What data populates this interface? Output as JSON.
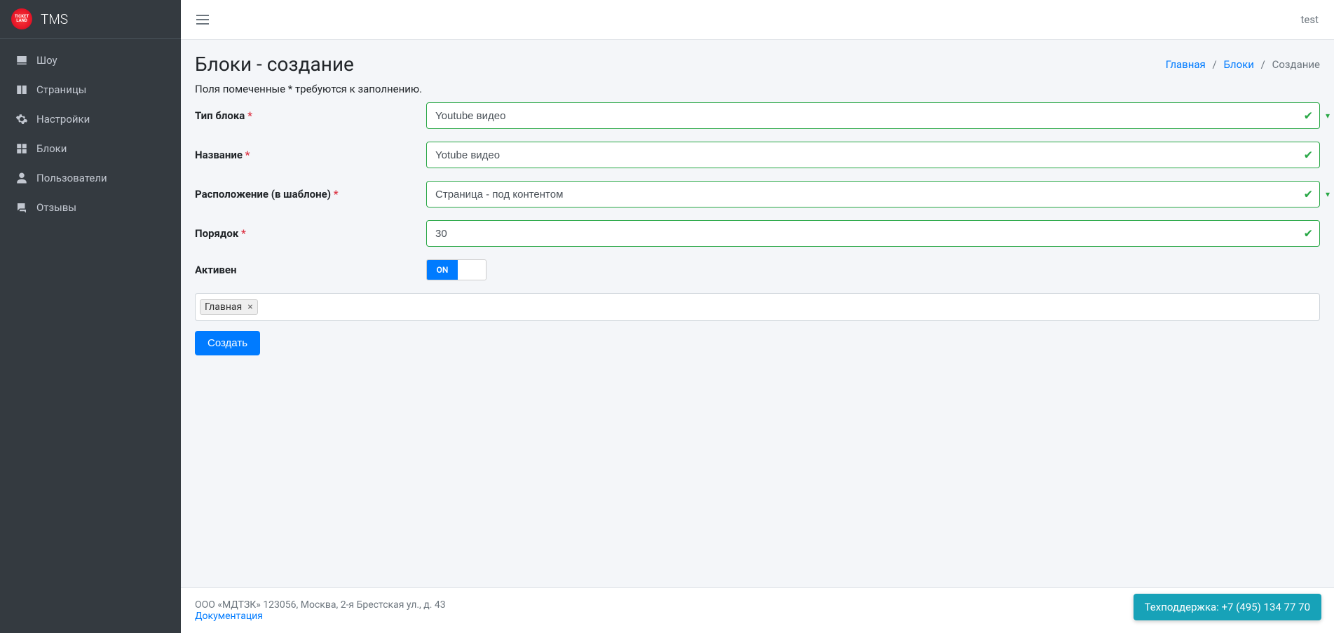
{
  "brand": {
    "name": "TMS",
    "logo_text": "TICKET LAND"
  },
  "topbar": {
    "user": "test"
  },
  "sidebar": {
    "items": [
      {
        "label": "Шоу"
      },
      {
        "label": "Страницы"
      },
      {
        "label": "Настройки"
      },
      {
        "label": "Блоки"
      },
      {
        "label": "Пользователи"
      },
      {
        "label": "Отзывы"
      }
    ]
  },
  "header": {
    "title": "Блоки - создание",
    "breadcrumb": {
      "home": "Главная",
      "parent": "Блоки",
      "current": "Создание"
    }
  },
  "form": {
    "hint": "Поля помеченные * требуются к заполнению.",
    "type_label": "Тип блока",
    "type_value": "Youtube видео",
    "name_label": "Название",
    "name_value": "Yotube видео",
    "placement_label": "Расположение (в шаблоне)",
    "placement_value": "Страница - под контентом",
    "order_label": "Порядок",
    "order_value": "30",
    "active_label": "Активен",
    "active_value": "ON",
    "tag": "Главная",
    "submit": "Создать"
  },
  "footer": {
    "company": "ООО «МДТЗК» 123056, Москва, 2-я Брестская ул., д. 43",
    "docs": "Документация"
  },
  "support": {
    "label": "Техподдержка: +7 (495) 134 77 70"
  }
}
